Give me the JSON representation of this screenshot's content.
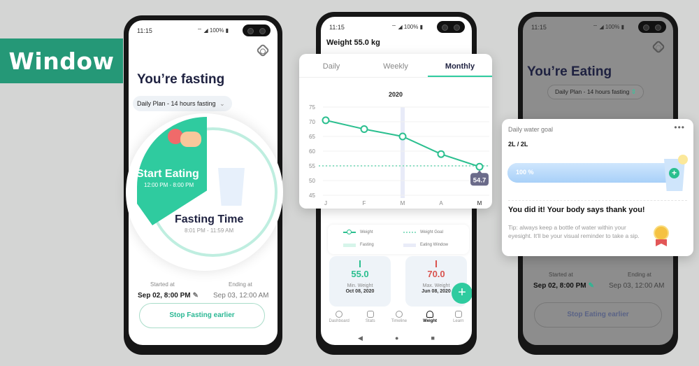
{
  "banner": {
    "label": "Window",
    "color": "#259877"
  },
  "accent_color": "#2fcb9f",
  "phone_fasting": {
    "status_time": "11:15",
    "status_icons": "wifi-icon signal-icon 100% battery-icon",
    "battery": "100%",
    "title": "You’re fasting",
    "plan_selector": "Daily Plan - 14 hours fasting",
    "eating_label": "Start Eating",
    "eating_window": "12:00 PM - 8:00 PM",
    "fasting_label": "Fasting Time",
    "fasting_window": "8:01 PM - 11:59 AM",
    "started_label": "Started at",
    "started_value": "Sep 02, 8:00 PM",
    "ending_label": "Ending at",
    "ending_value": "Sep 03, 12:00 AM",
    "stop_button": "Stop Fasting earlier"
  },
  "phone_weight": {
    "status_time": "11:15",
    "battery": "100%",
    "title": "Weight 55.0 kg",
    "tabs": [
      {
        "label": "Daily",
        "active": false
      },
      {
        "label": "Weekly",
        "active": false
      },
      {
        "label": "Monthly",
        "active": true
      }
    ],
    "legend": {
      "weight": "Weight",
      "goal": "Weight Goal",
      "fasting": "Fasting",
      "eating": "Eating Window"
    },
    "min_card": {
      "value": "55.0",
      "label": "Min. Weight",
      "date": "Oct 08, 2020",
      "color": "#2bbf8f"
    },
    "max_card": {
      "value": "70.0",
      "label": "Max. Weight",
      "date": "Jun 08, 2020",
      "color": "#d9534f"
    },
    "fab": "+",
    "nav": [
      {
        "label": "Dashboard",
        "icon": "dashboard-icon",
        "active": false
      },
      {
        "label": "Stats",
        "icon": "stats-icon",
        "active": false
      },
      {
        "label": "Timeline",
        "icon": "timeline-icon",
        "active": false
      },
      {
        "label": "Weight",
        "icon": "scale-icon",
        "active": true
      },
      {
        "label": "Learn",
        "icon": "book-icon",
        "active": false
      }
    ],
    "system_nav": {
      "back": "◀",
      "home": "●",
      "recents": "■"
    }
  },
  "chart_data": {
    "type": "line",
    "title": "2020",
    "categories": [
      "J",
      "F",
      "M",
      "A",
      "M"
    ],
    "series": [
      {
        "name": "Weight",
        "values": [
          70.5,
          67.5,
          65.0,
          59.0,
          54.7
        ],
        "color": "#2bbf8f"
      }
    ],
    "goal": {
      "name": "Weight Goal",
      "value": 55
    },
    "highlight_category_index": 2,
    "highlight_label": "Eating Window",
    "callout": {
      "index": 4,
      "label": "54.7"
    },
    "yticks": [
      45,
      50,
      55,
      60,
      65,
      70,
      75
    ],
    "ylim": [
      45,
      75
    ],
    "xlabel": "",
    "ylabel": "",
    "grid": true
  },
  "phone_eating": {
    "status_time": "11:15",
    "battery": "100%",
    "title": "You’re Eating",
    "plan_selector": "Daily Plan - 14 hours fasting",
    "started_label": "Started at",
    "started_value": "Sep 02, 8:00 PM",
    "ending_label": "Ending at",
    "ending_value": "Sep 03, 12:00 AM",
    "stop_button": "Stop Eating earlier"
  },
  "water_card": {
    "title": "Daily water goal",
    "more": "•••",
    "amount": "2L / 2L",
    "progress_percent": 100,
    "progress_label": "100 %",
    "add": "+",
    "message": "You did it! Your body says thank you!",
    "tip": "Tip: always keep a bottle of water within your eyesight. It'll be your visual reminder to take a sip."
  }
}
